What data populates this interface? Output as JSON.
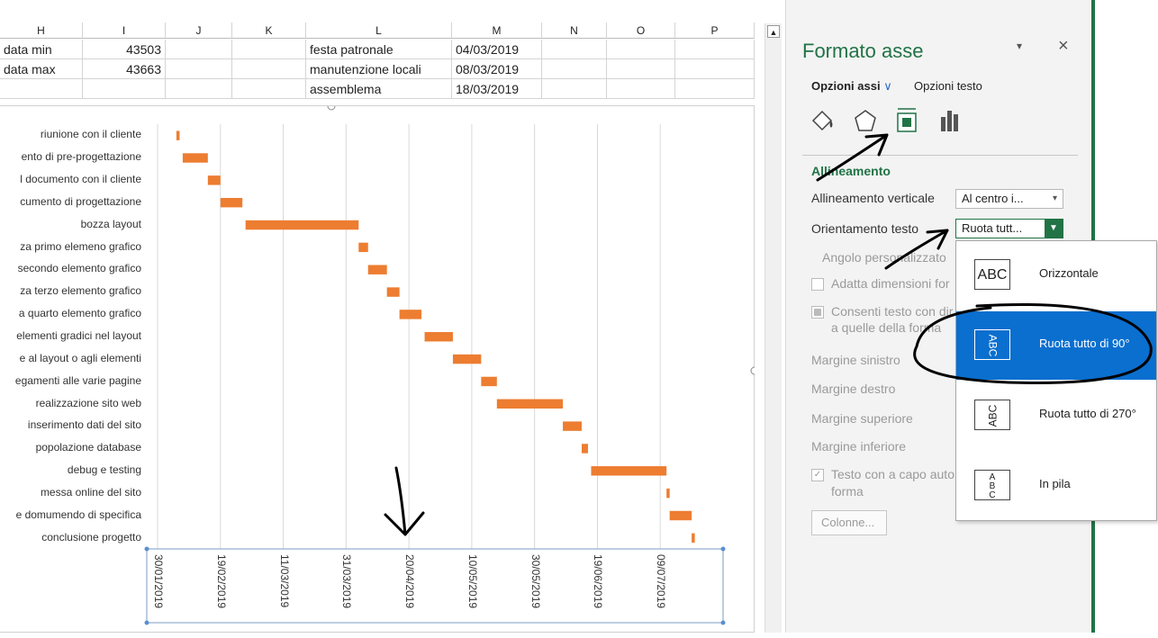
{
  "sheet": {
    "columns": [
      "H",
      "I",
      "J",
      "K",
      "L",
      "M",
      "N",
      "O",
      "P"
    ],
    "rows": [
      [
        "data min",
        "43503",
        "",
        "",
        "festa patronale",
        "04/03/2019",
        "",
        "",
        ""
      ],
      [
        "data max",
        "43663",
        "",
        "",
        "manutenzione locali",
        "08/03/2019",
        "",
        "",
        ""
      ],
      [
        "",
        "",
        "",
        "",
        "assemblema",
        "18/03/2019",
        "",
        "",
        ""
      ]
    ]
  },
  "chart_data": {
    "type": "bar",
    "tasks": [
      {
        "label": "riunione con il cliente",
        "start": "2019-02-05",
        "end": "2019-02-06"
      },
      {
        "label": "ento di pre-progettazione",
        "start": "2019-02-07",
        "end": "2019-02-15"
      },
      {
        "label": "l documento con il cliente",
        "start": "2019-02-15",
        "end": "2019-02-19"
      },
      {
        "label": "cumento di progettazione",
        "start": "2019-02-19",
        "end": "2019-02-26"
      },
      {
        "label": "bozza layout",
        "start": "2019-02-27",
        "end": "2019-04-04"
      },
      {
        "label": "za primo elemeno grafico",
        "start": "2019-04-04",
        "end": "2019-04-07"
      },
      {
        "label": "secondo elemento grafico",
        "start": "2019-04-07",
        "end": "2019-04-13"
      },
      {
        "label": "za terzo elemento grafico",
        "start": "2019-04-13",
        "end": "2019-04-17"
      },
      {
        "label": "a quarto elemento grafico",
        "start": "2019-04-17",
        "end": "2019-04-24"
      },
      {
        "label": "elementi gradici nel layout",
        "start": "2019-04-25",
        "end": "2019-05-04"
      },
      {
        "label": "e al layout o agli elementi",
        "start": "2019-05-04",
        "end": "2019-05-13"
      },
      {
        "label": "egamenti alle varie pagine",
        "start": "2019-05-13",
        "end": "2019-05-18"
      },
      {
        "label": "realizzazione sito web",
        "start": "2019-05-18",
        "end": "2019-06-08"
      },
      {
        "label": "inserimento dati del sito",
        "start": "2019-06-08",
        "end": "2019-06-14"
      },
      {
        "label": "popolazione database",
        "start": "2019-06-14",
        "end": "2019-06-16"
      },
      {
        "label": "debug e testing",
        "start": "2019-06-17",
        "end": "2019-07-11"
      },
      {
        "label": "messa online del sito",
        "start": "2019-07-11",
        "end": "2019-07-12"
      },
      {
        "label": "e domumendo di specifica",
        "start": "2019-07-12",
        "end": "2019-07-19"
      },
      {
        "label": "conclusione progetto",
        "start": "2019-07-19",
        "end": "2019-07-20"
      }
    ],
    "x_ticks": [
      "30/01/2019",
      "19/02/2019",
      "11/03/2019",
      "31/03/2019",
      "20/04/2019",
      "10/05/2019",
      "30/05/2019",
      "19/06/2019",
      "09/07/2019"
    ],
    "xlim": [
      "2019-01-30",
      "2019-07-29"
    ],
    "bar_color": "#ed7d31",
    "grid": true
  },
  "pane": {
    "title": "Formato asse",
    "tab_axis": "Opzioni assi",
    "tab_text": "Opzioni testo",
    "section": "Allineamento",
    "vertical_label": "Allineamento verticale",
    "vertical_value": "Al centro i...",
    "orient_label": "Orientamento testo",
    "orient_value": "Ruota tutt...",
    "angle_label": "Angolo personalizzato",
    "fit_label": "Adatta dimensioni for",
    "overflow_label": "Consenti testo con dir",
    "overflow_label2": "a quelle della forma",
    "margin_left": "Margine sinistro",
    "margin_right": "Margine destro",
    "margin_top": "Margine superiore",
    "margin_bottom": "Margine inferiore",
    "wrap_label": "Testo con a capo auto",
    "wrap_label2": "forma",
    "columns_button": "Colonne...",
    "icons": [
      "fill-line-icon",
      "effects-pentagon-icon",
      "size-properties-icon",
      "axis-options-bar-icon"
    ],
    "accent": "#217346"
  },
  "dropdown": {
    "options": [
      {
        "box": "ABC",
        "label": "Orizzontale",
        "selected": false
      },
      {
        "box": "ABC",
        "label": "Ruota tutto di 90°",
        "selected": true
      },
      {
        "box": "ABC",
        "label": "Ruota tutto di 270°",
        "selected": false
      },
      {
        "box": "A B C",
        "label": "In pila",
        "selected": false
      }
    ],
    "highlight": "#0a6fcf"
  }
}
